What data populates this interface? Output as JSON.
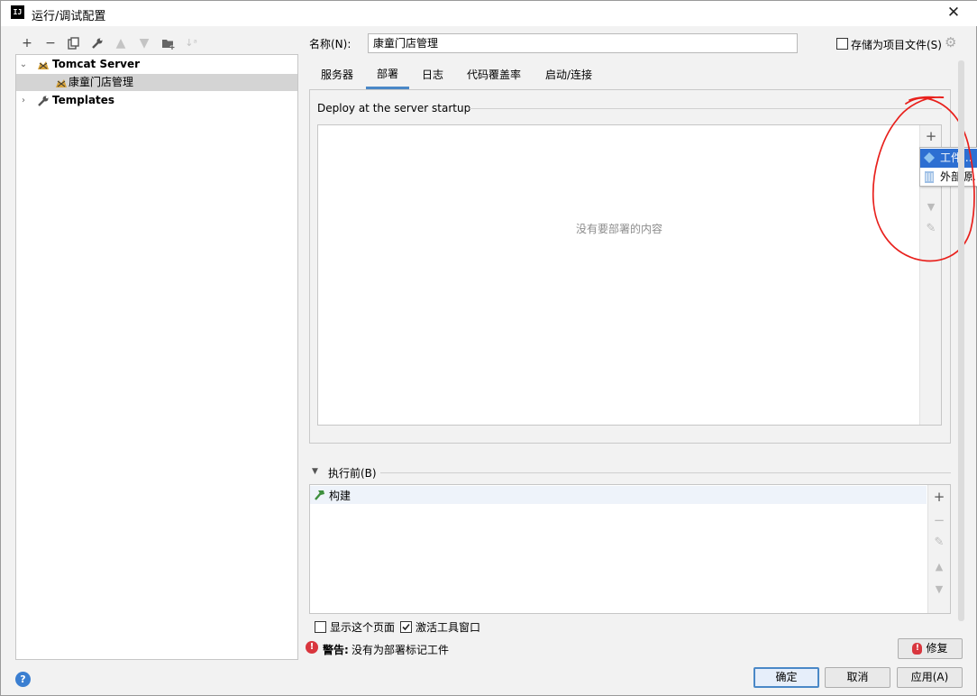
{
  "window": {
    "title": "运行/调试配置",
    "app_icon_text": "IJ"
  },
  "toolbar": {
    "icons": [
      "plus-icon",
      "minus-icon",
      "copy-icon",
      "wrench-icon",
      "arrow-up-icon",
      "arrow-down-icon",
      "folder-add-icon",
      "sort-icon"
    ]
  },
  "tree": {
    "groups": [
      {
        "label": "Tomcat Server",
        "expanded": true,
        "children": [
          {
            "label": "康童门店管理",
            "selected": true
          }
        ]
      },
      {
        "label": "Templates",
        "expanded": false,
        "children": []
      }
    ]
  },
  "name_field": {
    "label": "名称(N):",
    "value": "康童门店管理"
  },
  "store_as_project_file": {
    "label": "存储为项目文件(S)",
    "checked": false
  },
  "tabs": [
    {
      "label": "服务器",
      "active": false
    },
    {
      "label": "部署",
      "active": true
    },
    {
      "label": "日志",
      "active": false
    },
    {
      "label": "代码覆盖率",
      "active": false
    },
    {
      "label": "启动/连接",
      "active": false
    }
  ],
  "deploy": {
    "section_title": "Deploy at the server startup",
    "empty_text": "没有要部署的内容",
    "popup_menu": [
      {
        "label": "工件...",
        "icon": "artifact-icon",
        "selected": true
      },
      {
        "label": "外部源...",
        "icon": "external-source-icon",
        "selected": false
      }
    ]
  },
  "before_launch": {
    "title": "执行前(B)",
    "items": [
      {
        "label": "构建",
        "icon": "hammer-icon"
      }
    ]
  },
  "options": {
    "show_page": {
      "label": "显示这个页面",
      "checked": false
    },
    "activate_tool_window": {
      "label": "激活工具窗口",
      "checked": true
    }
  },
  "warning": {
    "prefix": "警告:",
    "text": "没有为部署标记工件"
  },
  "buttons": {
    "fix": "修复",
    "ok": "确定",
    "cancel": "取消",
    "apply": "应用(A)"
  },
  "colors": {
    "accent": "#4a88c7",
    "selection": "#2d6fd2",
    "annotation": "#e8201c",
    "warning": "#d9363e"
  }
}
